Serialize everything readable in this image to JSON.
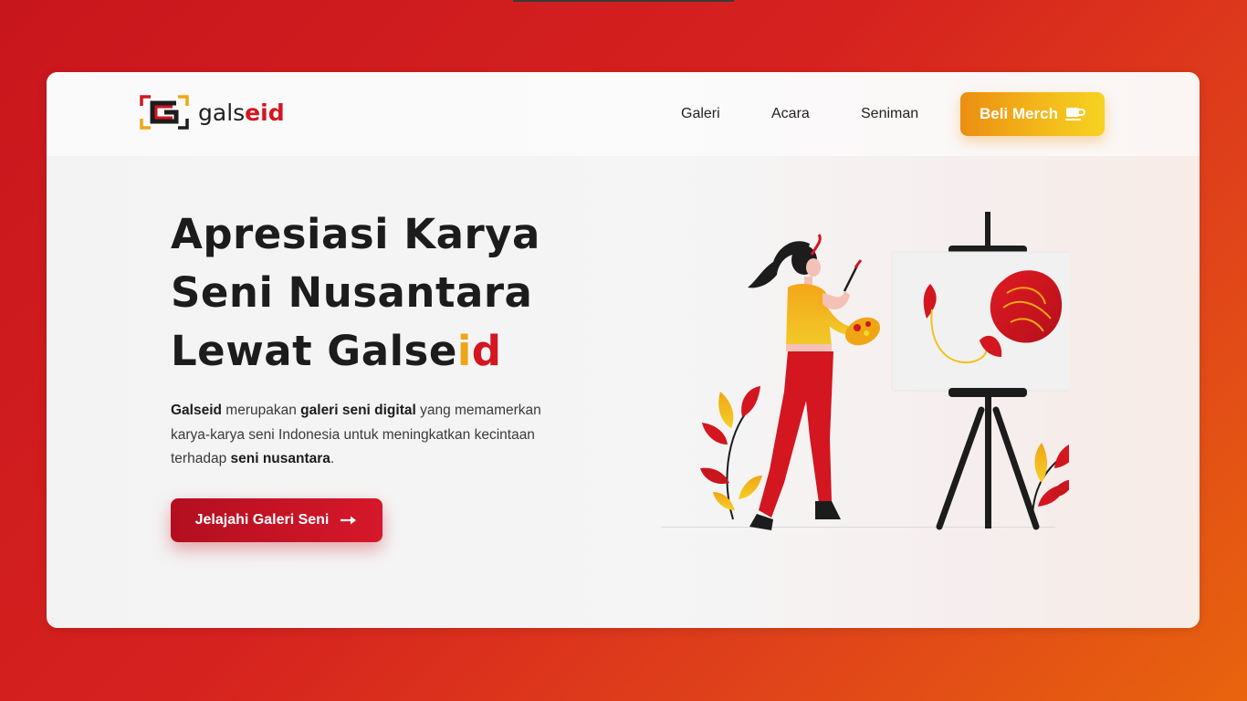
{
  "brand": {
    "name_main": "gals",
    "name_accent": "eid",
    "logo_icon": "g-bracket-logo-icon",
    "accent_color": "#d3161f",
    "secondary_color": "#f0a515"
  },
  "nav": {
    "items": [
      {
        "label": "Galeri"
      },
      {
        "label": "Acara"
      },
      {
        "label": "Seniman"
      }
    ],
    "merch_button": {
      "label": "Beli Merch",
      "icon": "coffee-cup-icon"
    }
  },
  "hero": {
    "title_line1": "Apresiasi Karya",
    "title_line2": "Seni Nusantara",
    "title_line3_prefix": "Lewat Galse",
    "title_line3_i": "i",
    "title_line3_d": "d",
    "description": {
      "p1_bold": "Galseid",
      "p2": " merupakan ",
      "p3_bold": "galeri seni digital",
      "p4": " yang memamerkan karya-karya seni Indonesia untuk meningkatkan kecintaan terhadap ",
      "p5_bold": "seni nusantara",
      "p6": "."
    },
    "cta": {
      "label": "Jelajahi Galeri Seni",
      "icon": "arrow-right-icon"
    }
  },
  "illustration": {
    "subject": "woman-painting-at-easel-illustration"
  },
  "colors": {
    "background_start": "#c8161d",
    "background_end": "#e8640e",
    "cta_start": "#b30f1f",
    "cta_end": "#d6182a",
    "merch_start": "#ec8d12",
    "merch_end": "#f6d322"
  }
}
